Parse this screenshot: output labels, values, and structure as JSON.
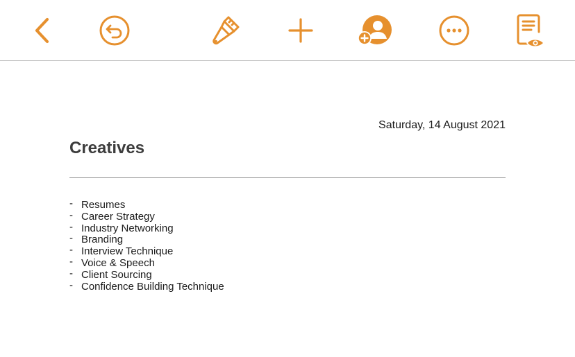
{
  "toolbar": {
    "accent_color": "#e6902e",
    "buttons": [
      {
        "name": "back-button",
        "icon": "chevron-left-icon"
      },
      {
        "name": "undo-button",
        "icon": "undo-circle-icon"
      },
      {
        "name": "format-button",
        "icon": "paintbrush-icon"
      },
      {
        "name": "insert-button",
        "icon": "plus-icon"
      },
      {
        "name": "collaborate-button",
        "icon": "add-person-icon"
      },
      {
        "name": "more-button",
        "icon": "ellipsis-circle-icon"
      },
      {
        "name": "reading-view-button",
        "icon": "document-eye-icon"
      }
    ]
  },
  "document": {
    "date": "Saturday, 14 August 2021",
    "title": "Creatives",
    "bullet_marker": "-",
    "items": [
      "Resumes",
      "Career Strategy",
      "Industry Networking",
      "Branding",
      "Interview Technique",
      "Voice & Speech",
      "Client Sourcing",
      "Confidence Building Technique"
    ]
  }
}
